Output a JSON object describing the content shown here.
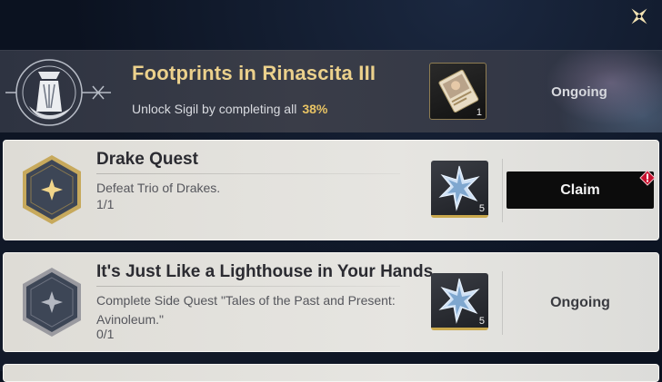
{
  "header": {
    "close_icon": "close-sparkle-icon",
    "banner": {
      "title": "Footprints in Rinascita III",
      "description": "Unlock Sigil by completing all",
      "progress_percent": "38%",
      "reward_count": "1",
      "reward_icon": "sigil-card-icon",
      "status": "Ongoing"
    }
  },
  "quests": [
    {
      "title": "Drake Quest",
      "description": "Defeat Trio of Drakes.",
      "progress": "1/1",
      "reward_icon": "star-crystal-icon",
      "reward_count": "5",
      "action_label": "Claim",
      "alert_icon": "red-alert-badge-icon"
    },
    {
      "title": "It's Just Like a Lighthouse in Your Hands",
      "description": "Complete Side Quest \"Tales of the Past and Present: Avinoleum.\"",
      "progress": "0/1",
      "reward_icon": "star-crystal-icon",
      "reward_count": "5",
      "status": "Ongoing"
    }
  ],
  "colors": {
    "accent_gold": "#e8c364",
    "title_gold": "#ecd18c",
    "card_bg": "#e3e2de",
    "claim_bg": "#0c0c0c",
    "alert_red": "#c8102e"
  }
}
